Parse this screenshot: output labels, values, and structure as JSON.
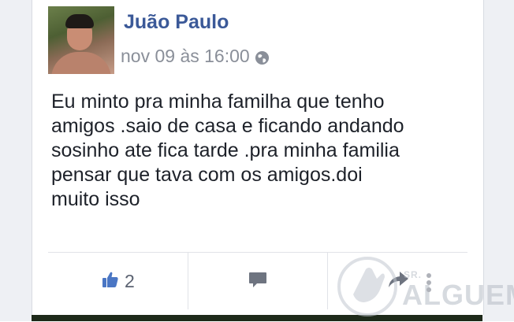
{
  "post": {
    "author": "Juão Paulo",
    "timestamp": "nov 09 às 16:00",
    "privacy_icon": "globe-icon",
    "text_lines": [
      "Eu minto pra minha familha que tenho",
      "amigos .saio de casa e ficando andando",
      "sosinho ate fica tarde .pra minha familia",
      "pensar que tava com os amigos.doi",
      "muito isso"
    ]
  },
  "actions": {
    "like_icon": "thumbs-up-icon",
    "like_count": "2",
    "comment_icon": "comment-icon",
    "share_icon": "share-icon",
    "more_icon": "more-vertical-icon"
  },
  "watermark": {
    "small": "SR.",
    "big": "ALGUEM"
  },
  "colors": {
    "author_name": "#3b5998",
    "like_blue": "#4a76c4",
    "icon_gray": "#6e7480"
  }
}
